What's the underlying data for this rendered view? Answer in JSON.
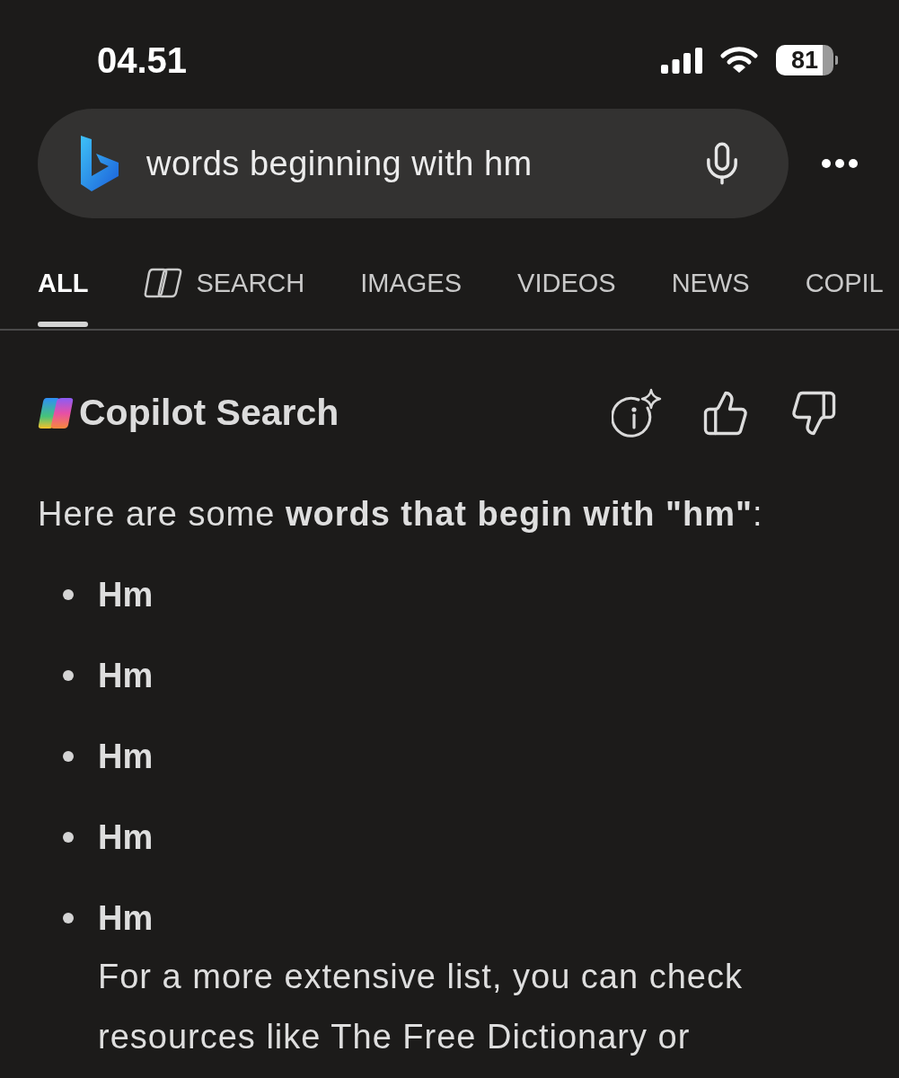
{
  "status_bar": {
    "time": "04.51",
    "battery": "81"
  },
  "search_bar": {
    "value": "words beginning with hm"
  },
  "tabs": [
    {
      "label": "ALL",
      "kind": "text",
      "selected": true
    },
    {
      "label": "SEARCH",
      "kind": "icon",
      "selected": false
    },
    {
      "label": "IMAGES",
      "kind": "text",
      "selected": false
    },
    {
      "label": "VIDEOS",
      "kind": "text",
      "selected": false
    },
    {
      "label": "NEWS",
      "kind": "text",
      "selected": false
    },
    {
      "label": "COPIL",
      "kind": "text",
      "selected": false
    }
  ],
  "answer": {
    "title": "Copilot Search",
    "intro": "Here are some **words that begin with \"hm\"**:",
    "items": [
      {
        "word": "Hm"
      },
      {
        "word": "Hm"
      },
      {
        "word": "Hm"
      },
      {
        "word": "Hm"
      },
      {
        "word": "Hm",
        "note": "For a more extensive list, you can check resources like The Free Dictionary or"
      }
    ]
  }
}
